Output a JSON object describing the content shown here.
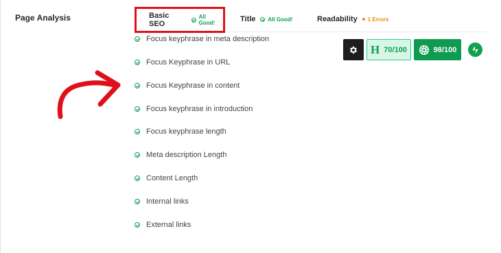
{
  "section": {
    "label": "Page Analysis"
  },
  "tabs": [
    {
      "label": "Basic SEO",
      "status": "All Good!"
    },
    {
      "label": "Title",
      "status": "All Good!"
    },
    {
      "label": "Readability",
      "status": "1 Errors"
    }
  ],
  "checks": [
    {
      "label": "Focus keyphrase in meta description"
    },
    {
      "label": "Focus Keyphrase in URL"
    },
    {
      "label": "Focus Keyphrase in content"
    },
    {
      "label": "Focus keyphrase in introduction"
    },
    {
      "label": "Focus keyphrase length"
    },
    {
      "label": "Meta description Length"
    },
    {
      "label": "Content Length"
    },
    {
      "label": "Internal links"
    },
    {
      "label": "External links"
    }
  ],
  "toolbar": {
    "headline_letter": "H",
    "headline_score": "70/100",
    "seo_score": "98/100"
  },
  "colors": {
    "good": "#0d9e4f",
    "error": "#e88b0a",
    "highlight": "#e0101b",
    "annotation_arrow": "#e0101b"
  }
}
